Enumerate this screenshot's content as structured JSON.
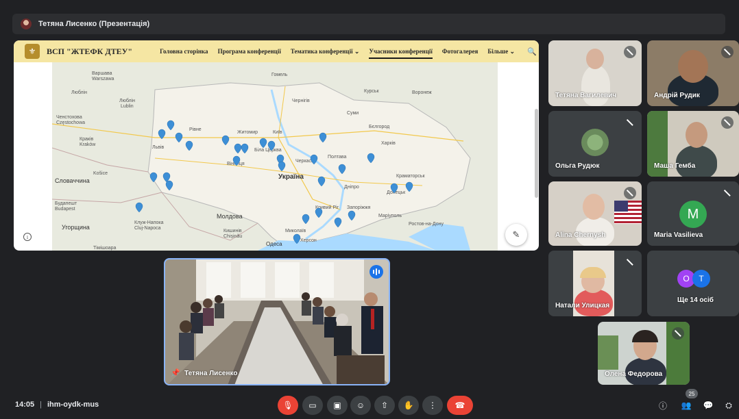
{
  "presenter": {
    "label": "Тетяна Лисенко (Презентація)"
  },
  "website": {
    "name": "ВСП \"ЖТЕФК ДТЕУ\"",
    "nav": [
      {
        "label": "Головна сторінка"
      },
      {
        "label": "Програма конференції"
      },
      {
        "label": "Тематика конференції ⌄"
      },
      {
        "label": "Учасники конференції"
      },
      {
        "label": "Фотогалерея"
      },
      {
        "label": "Більше ⌄"
      }
    ],
    "active_nav": "Учасники конференції"
  },
  "map": {
    "labels": [
      "Варшава",
      "Warszawa",
      "Łódź",
      "Люблін",
      "Lublin",
      "Ченстохова",
      "Częstochowa",
      "Kraków",
      "Краків",
      "Львів",
      "Рівне",
      "Житомир",
      "Київ",
      "Чернігів",
      "Суми",
      "Харків",
      "Полтава",
      "Україна",
      "Вінниця",
      "Біла Церква",
      "Черкаси",
      "Дніпро",
      "Запоріжжя",
      "Кривий Ріг",
      "Миколаїв",
      "Херсон",
      "Одеса",
      "Молдова",
      "Chișinău",
      "Кишинів",
      "Словаччина",
      "Košice",
      "Угорщина",
      "Budapest",
      "Будапешт",
      "Клуж-Напока",
      "Cluj-Napoca",
      "Донецьк",
      "Маріуполь",
      "Ростов-на-Дону",
      "Краматорськ",
      "Воронеж",
      "Бєлгород",
      "Курськ",
      "Гомель",
      "Тімішоара"
    ],
    "pin_color": "#3d8fd6"
  },
  "participants": [
    {
      "name": "Тетяна Вагилевич",
      "muted": true
    },
    {
      "name": "Андрій Рудик",
      "muted": true
    },
    {
      "name": "Ольга Рудюк",
      "muted": true
    },
    {
      "name": "Маша Гемба",
      "muted": true
    },
    {
      "name": "Alina Chernysh",
      "muted": true
    },
    {
      "name": "Maria Vasilieva",
      "muted": true,
      "initial": "M",
      "color": "#34a853"
    },
    {
      "name": "Натали Улицкая",
      "muted": true
    },
    {
      "name": "Ще 14 осіб",
      "initials": [
        "O",
        "T"
      ],
      "colors": [
        "#a142f4",
        "#1a73e8"
      ]
    },
    {
      "name": "Олена Федорова",
      "muted": true
    }
  ],
  "main_video": {
    "name": "Тетяна Лисенко"
  },
  "meeting": {
    "time": "14:05",
    "code": "ihm-oydk-mus",
    "participant_count": "25"
  }
}
